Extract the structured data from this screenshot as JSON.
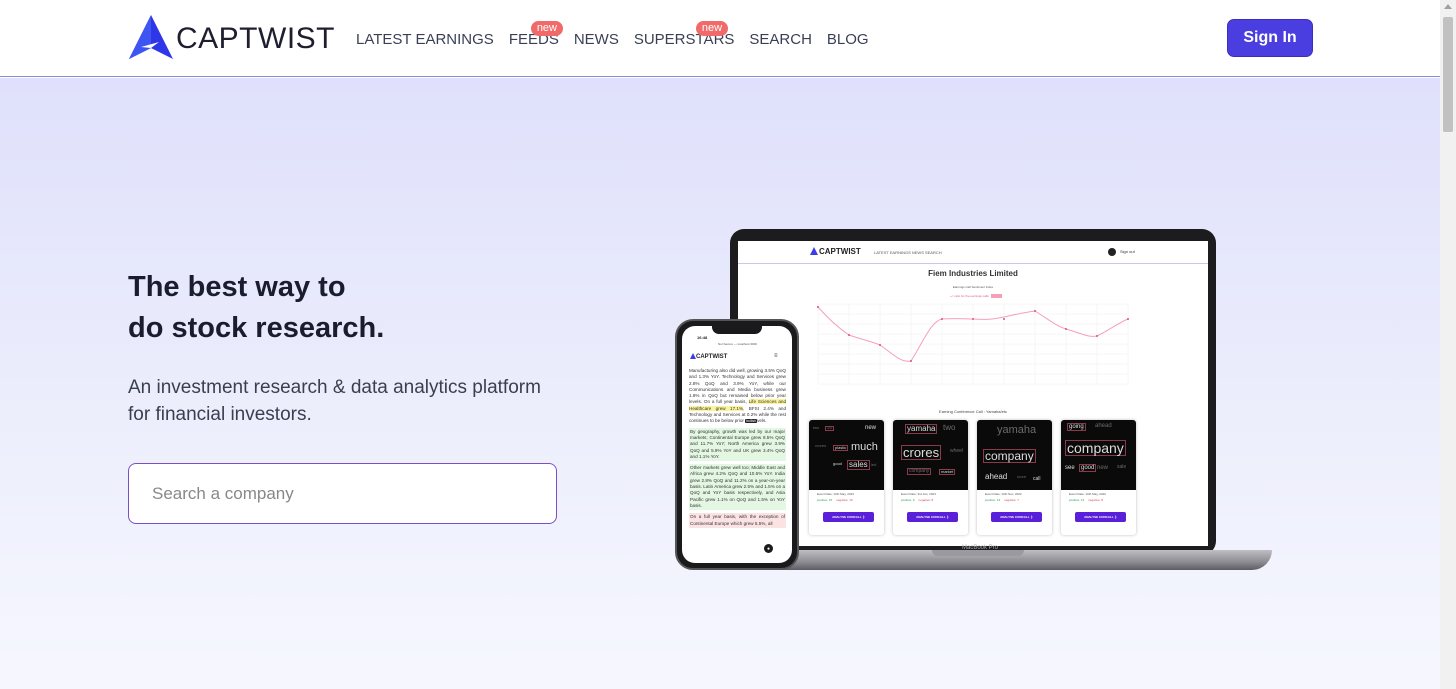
{
  "brand": {
    "name": "CAPTWIST",
    "accent": "#4b3ee0"
  },
  "nav": [
    {
      "label": "LATEST EARNINGS",
      "badge": ""
    },
    {
      "label": "FEEDS",
      "badge": "new"
    },
    {
      "label": "NEWS",
      "badge": ""
    },
    {
      "label": "SUPERSTARS",
      "badge": "new"
    },
    {
      "label": "SEARCH",
      "badge": ""
    },
    {
      "label": "BLOG",
      "badge": ""
    }
  ],
  "signin_label": "Sign In",
  "hero": {
    "headline_line1": "The best way to",
    "headline_line2": "do stock research.",
    "subline": "An investment research & data analytics platform for financial investors.",
    "search_placeholder": "Search a company"
  },
  "mockup": {
    "laptop": {
      "logo": "CAPTWIST",
      "nav": "LATEST EARNINGS   NEWS   SEARCH",
      "signout": "Sign out",
      "company": "Fiem Industries Limited",
      "chart_title": "Earnings Call Sentiment Index",
      "legend": "+/- ratio for the earnings calls",
      "section_title": "Earning Conference Call : Yamaha/etc",
      "device_label": "MacBook Pro",
      "cards": [
        {
          "date": "Event Date: 10th May, 2023",
          "positive": "positive: 15",
          "negative": "negative: 10",
          "button": "ANALYSE CONCALL  ❯"
        },
        {
          "date": "Event Date: 3rd Jan, 2023",
          "positive": "positive: 9",
          "negative": "negative: 8",
          "button": "ANALYSE CONCALL  ❯"
        },
        {
          "date": "Event Date: 10th Nov, 2022",
          "positive": "positive: 13",
          "negative": "negative: 7",
          "button": "ANALYSE CONCALL  ❯"
        },
        {
          "date": "Event Date: 10th May, 2022",
          "positive": "positive: 13",
          "negative": "negative: 8",
          "button": "ANALYSE CONCALL  ❯"
        }
      ]
    },
    "phone": {
      "time": "16:48",
      "url": "Not Secure — localhost:3000",
      "logo": "CAPTWIST",
      "para1a": "Manufacturing also did well, growing 3.5% QoQ and 1.3% YoY. Technology and Services grew 2.8% QoQ and 3.9% YoY, while our Communications and Media business grew 1.8% in QoQ but remained below prior year levels. On a full year basis, ",
      "para1_hl": "Life Sciences and Healthcare grew 17.1%",
      "para1b": ", BFSI 2.4% and Technology and Services at 0.2% while the rest continues to be below prior ",
      "para1_tag": "bullish",
      "para1c": "vels.",
      "para2": "By geography, growth was led by our major markets; Continental Europe grew 8.5% QoQ and 11.7% YoY; North America grew 3.9% QoQ and 5.9% YoY and UK grew 3.4% QoQ and 1.1% YoY.",
      "para3": "Other markets grew well too; Middle East and Africa grew 4.2% QoQ and 10.6% YoY. India grew 2.8% QoQ and 11.2% on a year-on-year basis. Latin America grew 2.5% and 1.5% on a QoQ and YoY basis respectively, and Asia Pacific grew 1.1% on QoQ and 1.5% on YoY basis.",
      "para4": "On a full year basis, with the exception of Continental Europe which grew 5.5%, all"
    }
  },
  "colors": {
    "hero_top": "#dfe0fb",
    "hero_bottom": "#f6f7fe",
    "badge": "#f06a6a",
    "button": "#4b3ee0"
  }
}
